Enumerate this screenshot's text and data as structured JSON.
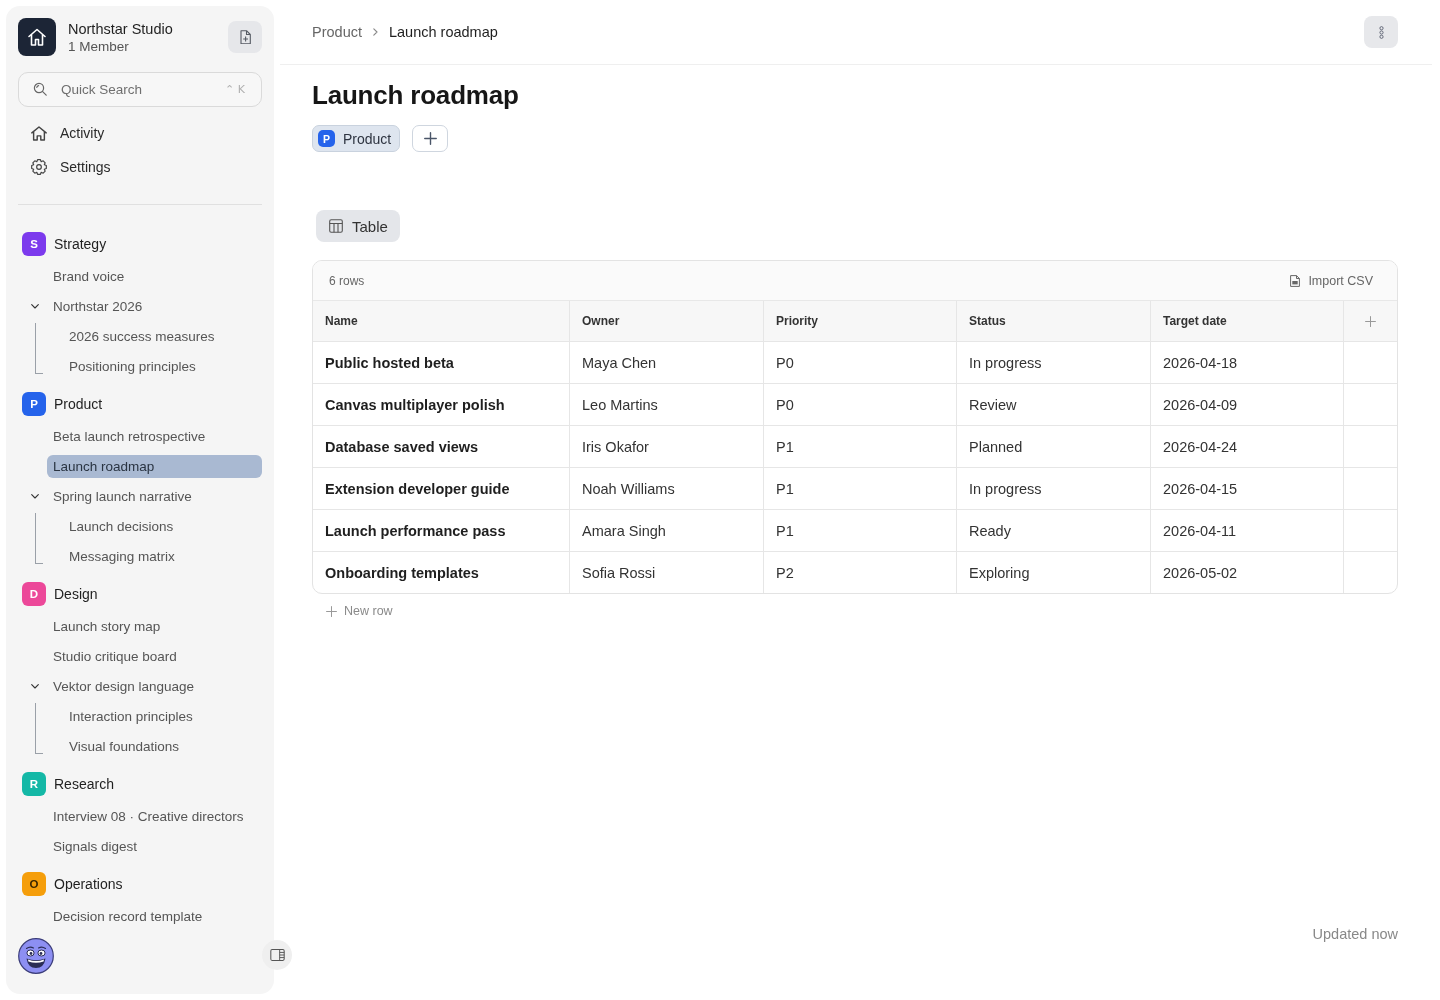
{
  "sidebar": {
    "workspace": {
      "name": "Northstar Studio",
      "members": "1 Member"
    },
    "search": {
      "placeholder": "Quick Search",
      "shortcut": "⌃ K"
    },
    "nav": [
      "Activity",
      "Settings"
    ],
    "groups": [
      {
        "badge": "S",
        "label": "Strategy",
        "color": "#7c3aed",
        "items": [
          {
            "label": "Brand voice",
            "selected": false
          },
          {
            "label": "Northstar 2026",
            "selected": false,
            "expanded": true,
            "children": [
              {
                "label": "2026 success measures",
                "selected": false
              },
              {
                "label": "Positioning principles",
                "selected": false
              }
            ]
          }
        ]
      },
      {
        "badge": "P",
        "label": "Product",
        "color": "#2563eb",
        "items": [
          {
            "label": "Beta launch retrospective",
            "selected": false
          },
          {
            "label": "Launch roadmap",
            "selected": true
          },
          {
            "label": "Spring launch narrative",
            "selected": false,
            "expanded": true,
            "children": [
              {
                "label": "Launch decisions",
                "selected": false
              },
              {
                "label": "Messaging matrix",
                "selected": false
              }
            ]
          }
        ]
      },
      {
        "badge": "D",
        "label": "Design",
        "color": "#ec4899",
        "items": [
          {
            "label": "Launch story map",
            "selected": false
          },
          {
            "label": "Studio critique board",
            "selected": false
          },
          {
            "label": "Vektor design language",
            "selected": false,
            "expanded": true,
            "children": [
              {
                "label": "Interaction principles",
                "selected": false
              },
              {
                "label": "Visual foundations",
                "selected": false
              }
            ]
          }
        ]
      },
      {
        "badge": "R",
        "label": "Research",
        "color": "#14b8a6",
        "items": [
          {
            "label": "Interview 08 · Creative directors",
            "selected": false
          },
          {
            "label": "Signals digest",
            "selected": false
          }
        ]
      },
      {
        "badge": "O",
        "label": "Operations",
        "color": "#f59e0b",
        "items": [
          {
            "label": "Decision record template",
            "selected": false
          }
        ]
      }
    ]
  },
  "header": {
    "breadcrumb": [
      "Product",
      "Launch roadmap"
    ]
  },
  "page": {
    "title": "Launch roadmap",
    "tags": [
      {
        "badge": "P",
        "label": "Product",
        "color": "#2563eb"
      }
    ],
    "views": [
      {
        "label": "Table",
        "selected": true
      }
    ]
  },
  "table": {
    "row_count": "6 rows",
    "import_label": "Import CSV",
    "columns": [
      "Name",
      "Owner",
      "Priority",
      "Status",
      "Target date"
    ],
    "rows": [
      [
        "Public hosted beta",
        "Maya Chen",
        "P0",
        "In progress",
        "2026-04-18"
      ],
      [
        "Canvas multiplayer polish",
        "Leo Martins",
        "P0",
        "Review",
        "2026-04-09"
      ],
      [
        "Database saved views",
        "Iris Okafor",
        "P1",
        "Planned",
        "2026-04-24"
      ],
      [
        "Extension developer guide",
        "Noah Williams",
        "P1",
        "In progress",
        "2026-04-15"
      ],
      [
        "Launch performance pass",
        "Amara Singh",
        "P1",
        "Ready",
        "2026-04-11"
      ],
      [
        "Onboarding templates",
        "Sofia Rossi",
        "P2",
        "Exploring",
        "2026-05-02"
      ]
    ],
    "new_row": "New row"
  },
  "status": "Updated now"
}
